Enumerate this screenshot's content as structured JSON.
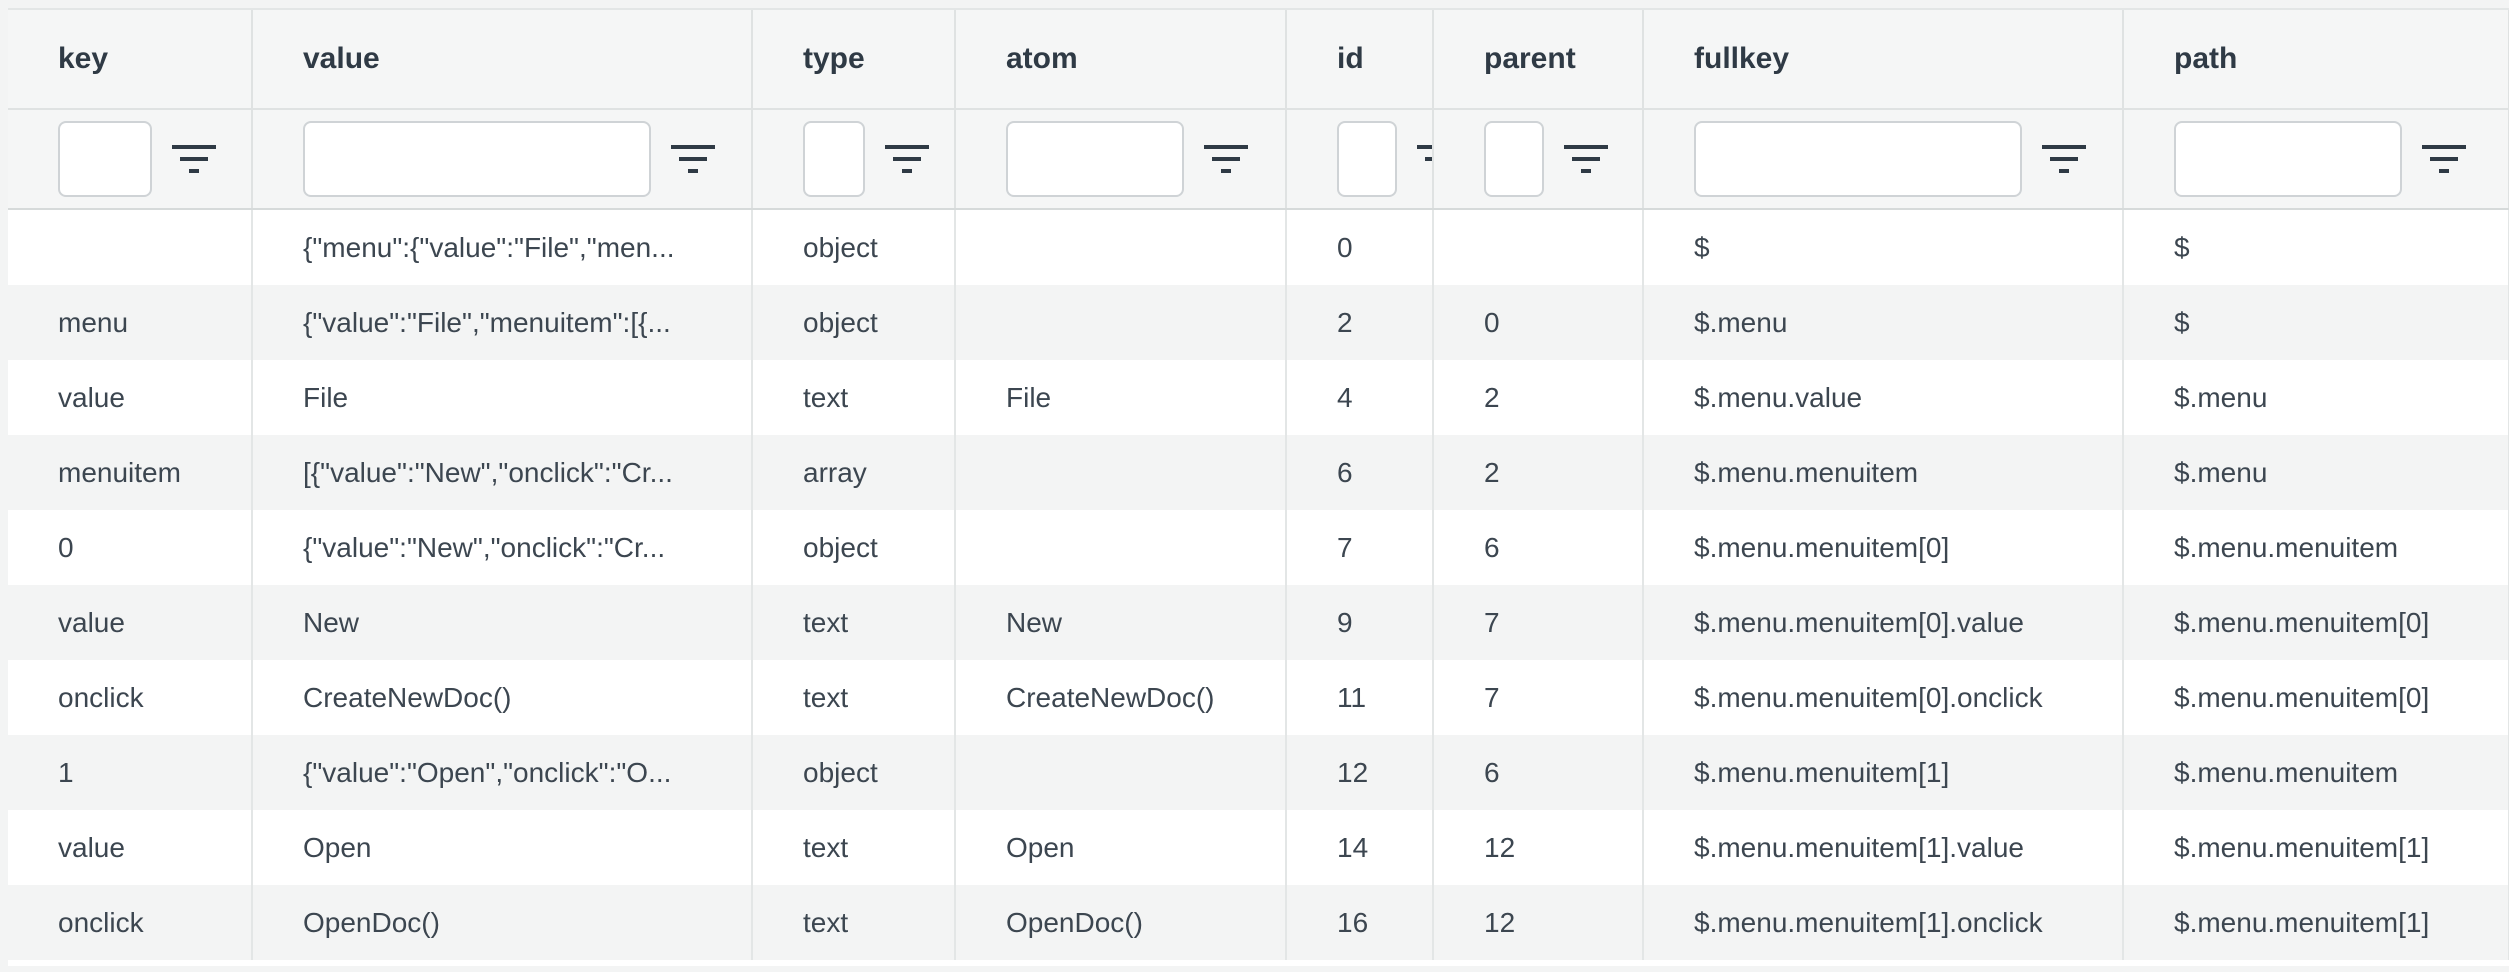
{
  "table": {
    "columns": [
      "key",
      "value",
      "type",
      "atom",
      "id",
      "parent",
      "fullkey",
      "path"
    ],
    "filters": [
      "",
      "",
      "",
      "",
      "",
      "",
      "",
      ""
    ],
    "rows": [
      [
        "",
        "{\"menu\":{\"value\":\"File\",\"men...",
        "object",
        "",
        "0",
        "",
        "$",
        "$"
      ],
      [
        "menu",
        "{\"value\":\"File\",\"menuitem\":[{...",
        "object",
        "",
        "2",
        "0",
        "$.menu",
        "$"
      ],
      [
        "value",
        "File",
        "text",
        "File",
        "4",
        "2",
        "$.menu.value",
        "$.menu"
      ],
      [
        "menuitem",
        "[{\"value\":\"New\",\"onclick\":\"Cr...",
        "array",
        "",
        "6",
        "2",
        "$.menu.menuitem",
        "$.menu"
      ],
      [
        "0",
        "{\"value\":\"New\",\"onclick\":\"Cr...",
        "object",
        "",
        "7",
        "6",
        "$.menu.menuitem[0]",
        "$.menu.menuitem"
      ],
      [
        "value",
        "New",
        "text",
        "New",
        "9",
        "7",
        "$.menu.menuitem[0].value",
        "$.menu.menuitem[0]"
      ],
      [
        "onclick",
        "CreateNewDoc()",
        "text",
        "CreateNewDoc()",
        "11",
        "7",
        "$.menu.menuitem[0].onclick",
        "$.menu.menuitem[0]"
      ],
      [
        "1",
        "{\"value\":\"Open\",\"onclick\":\"O...",
        "object",
        "",
        "12",
        "6",
        "$.menu.menuitem[1]",
        "$.menu.menuitem"
      ],
      [
        "value",
        "Open",
        "text",
        "Open",
        "14",
        "12",
        "$.menu.menuitem[1].value",
        "$.menu.menuitem[1]"
      ],
      [
        "onclick",
        "OpenDoc()",
        "text",
        "OpenDoc()",
        "16",
        "12",
        "$.menu.menuitem[1].onclick",
        "$.menu.menuitem[1]"
      ]
    ]
  },
  "icons": {
    "filter": "filter-icon"
  },
  "colors": {
    "header_bg": "#f5f6f6",
    "row_alt": "#f3f4f4",
    "text": "#3c4650",
    "border": "#dfe2e2"
  }
}
